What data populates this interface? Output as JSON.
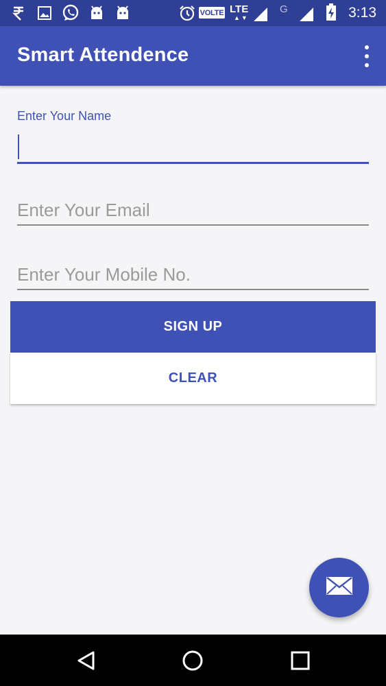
{
  "status_bar": {
    "time": "3:13",
    "volte": "VOLTE",
    "lte": "LTE",
    "network_g": "G",
    "icons": [
      "rupee-icon",
      "image-icon",
      "whatsapp-icon",
      "android-icon",
      "android-icon",
      "alarm-icon",
      "signal-icon",
      "signal-icon",
      "battery-charging-icon"
    ]
  },
  "app_bar": {
    "title": "Smart Attendence",
    "menu_icon": "more-vert-icon"
  },
  "form": {
    "name": {
      "label": "Enter Your Name",
      "value": ""
    },
    "email": {
      "placeholder": "Enter Your Email",
      "value": ""
    },
    "mobile": {
      "placeholder": "Enter Your Mobile No.",
      "value": ""
    }
  },
  "buttons": {
    "signup": "SIGN UP",
    "clear": "CLEAR"
  },
  "fab": {
    "icon": "mail-icon"
  },
  "nav": {
    "icons": [
      "back-icon",
      "home-icon",
      "recents-icon"
    ]
  },
  "colors": {
    "primary": "#3f51b5",
    "primary_dark": "#2f3f95",
    "background": "#f5f5f7"
  }
}
